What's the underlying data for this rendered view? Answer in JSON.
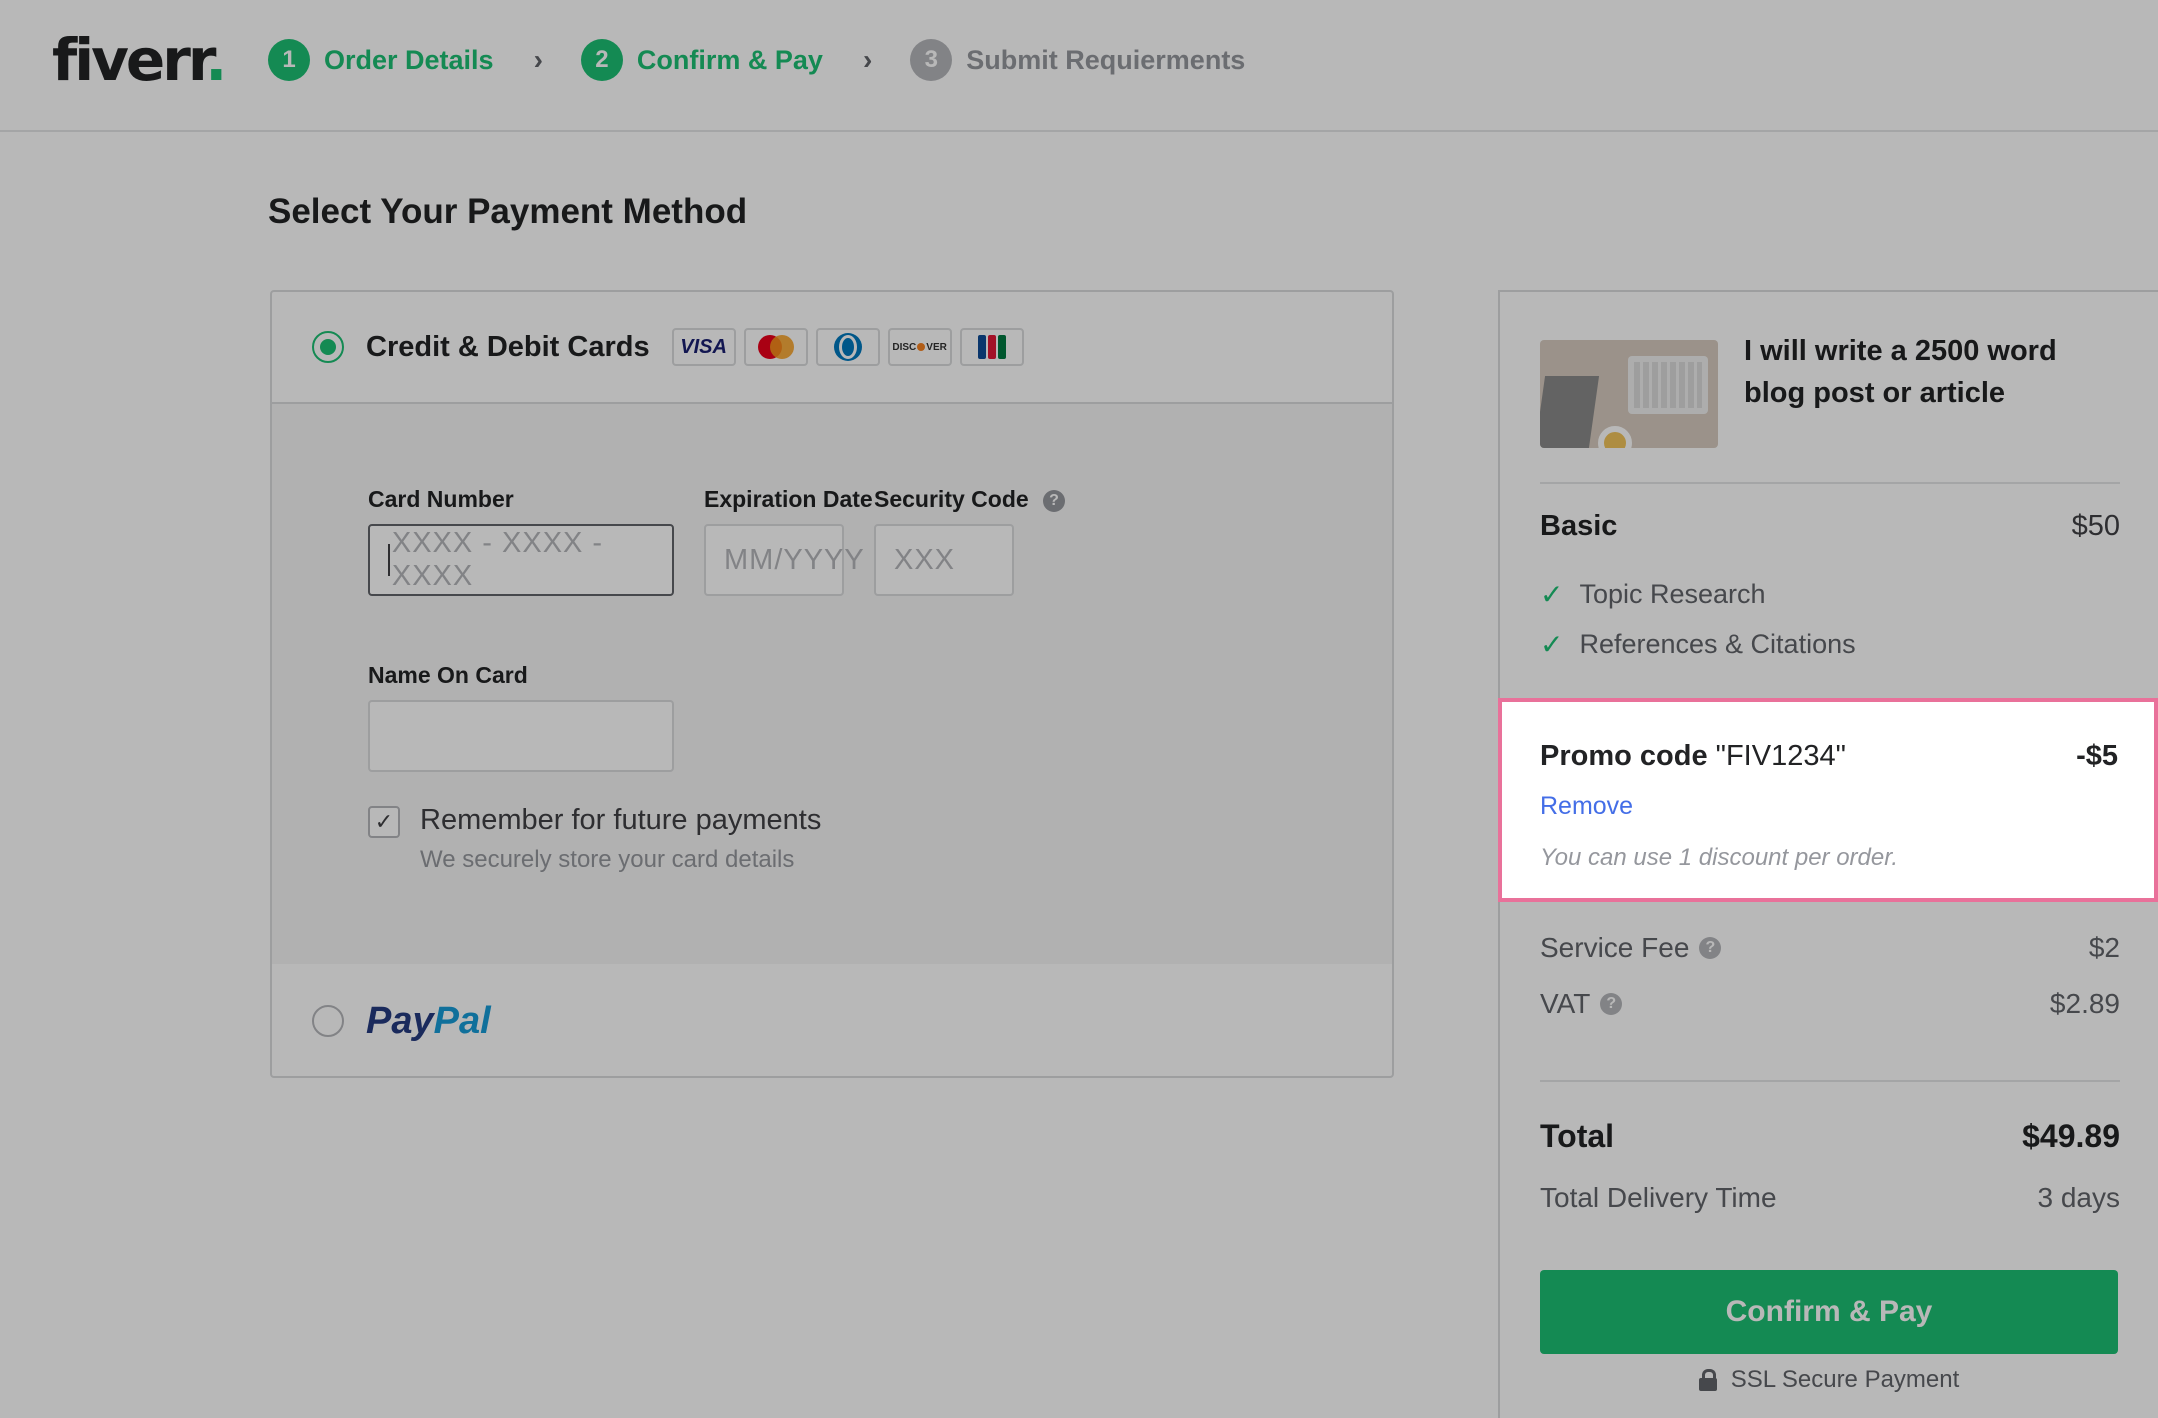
{
  "brand": {
    "name": "fiverr",
    "dot": ".",
    "accent": "#1dbf73"
  },
  "steps": [
    {
      "num": "1",
      "label": "Order Details",
      "state": "complete"
    },
    {
      "num": "2",
      "label": "Confirm & Pay",
      "state": "active"
    },
    {
      "num": "3",
      "label": "Submit Requierments",
      "state": "inactive"
    }
  ],
  "step_separator": "›",
  "payment": {
    "title": "Select Your Payment Method",
    "card_option": {
      "label": "Credit & Debit Cards",
      "selected": true,
      "brands": [
        "VISA",
        "Mastercard",
        "Diners Club",
        "DISCOVER",
        "JCB"
      ]
    },
    "card_number": {
      "label": "Card Number",
      "placeholder": "XXXX - XXXX - XXXX",
      "value": ""
    },
    "expiration": {
      "label": "Expiration Date",
      "placeholder": "MM/YYYY",
      "value": ""
    },
    "security": {
      "label": "Security Code",
      "placeholder": "XXX",
      "value": "",
      "help": "?"
    },
    "name_on_card": {
      "label": "Name On Card",
      "value": ""
    },
    "remember": {
      "label": "Remember for future payments",
      "sub": "We securely store your card details",
      "checked": true
    },
    "paypal": {
      "label_a": "Pay",
      "label_b": "Pal",
      "selected": false
    }
  },
  "summary": {
    "gig_title": "I will write a 2500 word blog post or article",
    "package": {
      "name": "Basic",
      "price": "$50"
    },
    "features": [
      "Topic Research",
      "References & Citations"
    ],
    "promo": {
      "label": "Promo code",
      "code": "\"FIV1234\"",
      "amount": "-$5",
      "remove": "Remove",
      "note": "You can use 1 discount per order."
    },
    "service_fee": {
      "label": "Service Fee",
      "value": "$2"
    },
    "vat": {
      "label": "VAT",
      "value": "$2.89"
    },
    "total": {
      "label": "Total",
      "value": "$49.89"
    },
    "delivery": {
      "label": "Total Delivery Time",
      "value": "3 days"
    },
    "confirm_button": "Confirm & Pay",
    "ssl": "SSL Secure Payment"
  }
}
